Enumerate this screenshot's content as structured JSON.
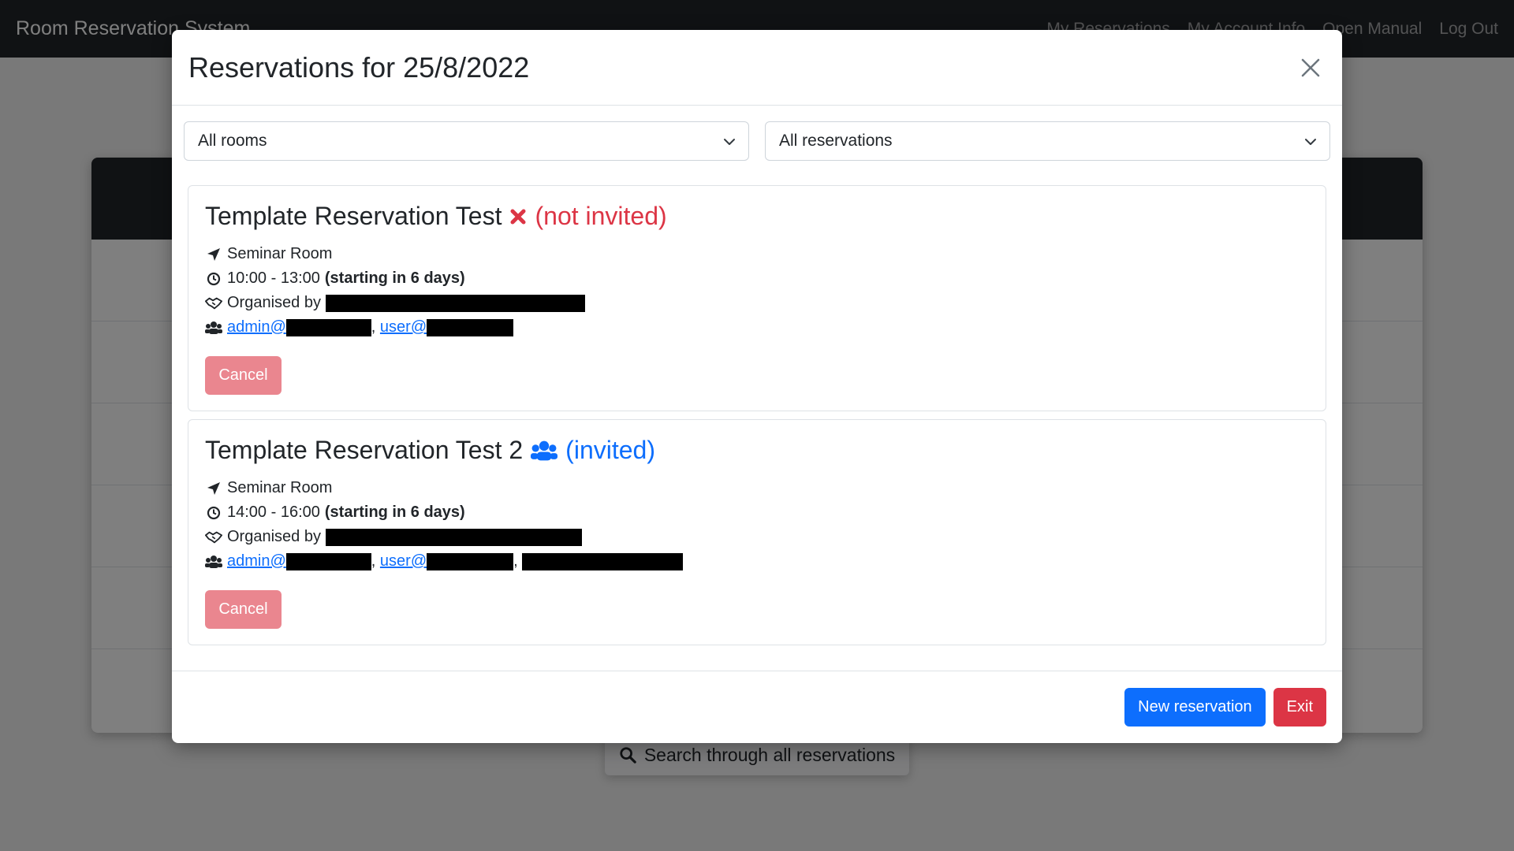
{
  "navbar": {
    "brand": "Room Reservation System",
    "links": [
      "My Reservations",
      "My Account Info",
      "Open Manual",
      "Log Out"
    ]
  },
  "background": {
    "search_label": "Search through all reservations"
  },
  "modal": {
    "title": "Reservations for 25/8/2022",
    "filters": {
      "room": "All rooms",
      "reservation": "All reservations"
    },
    "reservations": [
      {
        "title": "Template Reservation Test",
        "status_icon": "x-icon",
        "status": "(not invited)",
        "room": "Seminar Room",
        "time": "10:00 - 13:00",
        "relative": "(starting in 6 days)",
        "organised_label": "Organised by",
        "attendees": [
          "admin@",
          "user@"
        ],
        "cancel_label": "Cancel"
      },
      {
        "title": "Template Reservation Test 2",
        "status_icon": "users-icon",
        "status": "(invited)",
        "room": "Seminar Room",
        "time": "14:00 - 16:00",
        "relative": "(starting in 6 days)",
        "organised_label": "Organised by",
        "attendees": [
          "admin@",
          "user@"
        ],
        "cancel_label": "Cancel"
      }
    ],
    "footer": {
      "new_label": "New reservation",
      "exit_label": "Exit"
    }
  },
  "colors": {
    "primary": "#0d6efd",
    "danger": "#dc3545",
    "cancel_disabled": "#ea868f",
    "navbar": "#212529"
  }
}
